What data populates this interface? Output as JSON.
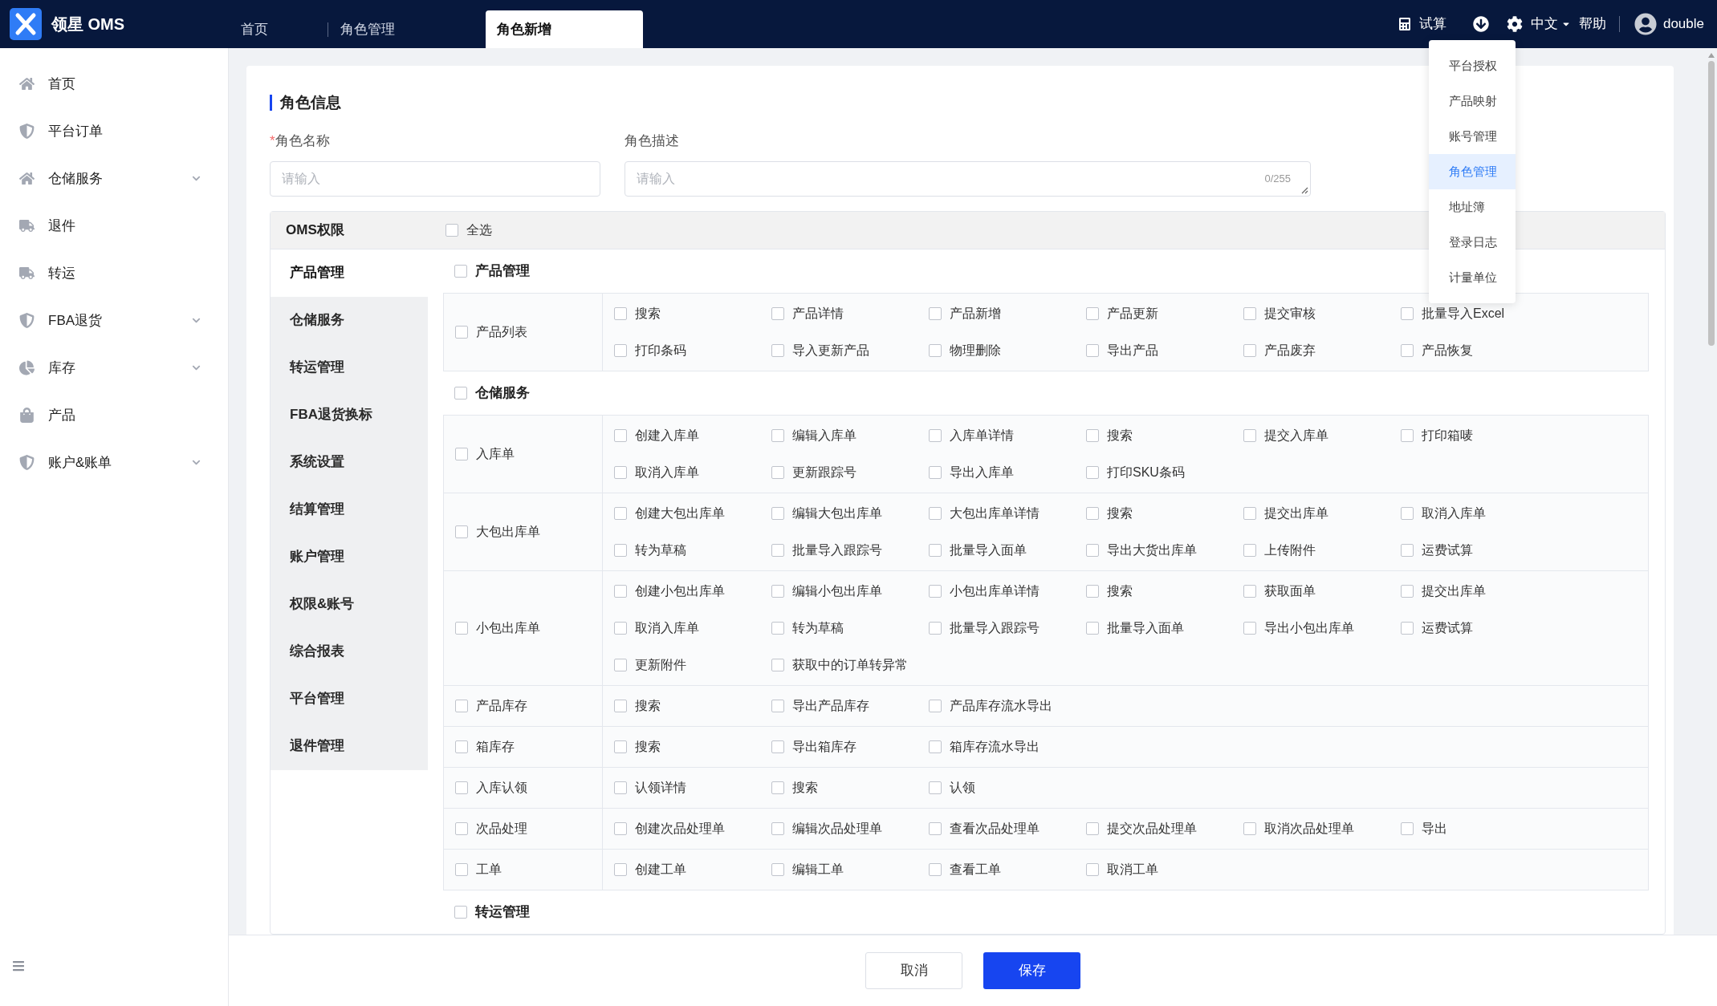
{
  "header": {
    "brand": "领星 OMS",
    "tabs": [
      {
        "label": "首页",
        "selected": false
      },
      {
        "label": "角色管理",
        "selected": false
      },
      {
        "label": "角色新增",
        "selected": true
      }
    ],
    "trial": "试算",
    "language": "中文",
    "help": "帮助",
    "user": "double"
  },
  "settings_menu": [
    {
      "label": "平台授权",
      "selected": false
    },
    {
      "label": "产品映射",
      "selected": false
    },
    {
      "label": "账号管理",
      "selected": false
    },
    {
      "label": "角色管理",
      "selected": true
    },
    {
      "label": "地址簿",
      "selected": false
    },
    {
      "label": "登录日志",
      "selected": false
    },
    {
      "label": "计量单位",
      "selected": false
    }
  ],
  "sidebar": {
    "items": [
      {
        "label": "首页",
        "expandable": false
      },
      {
        "label": "平台订单",
        "expandable": false
      },
      {
        "label": "仓储服务",
        "expandable": true
      },
      {
        "label": "退件",
        "expandable": false
      },
      {
        "label": "转运",
        "expandable": false
      },
      {
        "label": "FBA退货",
        "expandable": true
      },
      {
        "label": "库存",
        "expandable": true
      },
      {
        "label": "产品",
        "expandable": false
      },
      {
        "label": "账户&账单",
        "expandable": true
      }
    ]
  },
  "form": {
    "title": "角色信息",
    "name_field": {
      "required_mark": "*",
      "label": "角色名称",
      "placeholder": "请输入"
    },
    "description_field": {
      "label": "角色描述",
      "placeholder": "请输入",
      "counter": "0/255"
    }
  },
  "permissions": {
    "title": "OMS权限",
    "select_all": {
      "label": "全选",
      "checked": false
    },
    "modules": [
      {
        "label": "产品管理",
        "selected": true
      },
      {
        "label": "仓储服务",
        "selected": false
      },
      {
        "label": "转运管理",
        "selected": false
      },
      {
        "label": "FBA退货换标",
        "selected": false
      },
      {
        "label": "系统设置",
        "selected": false
      },
      {
        "label": "结算管理",
        "selected": false
      },
      {
        "label": "账户管理",
        "selected": false
      },
      {
        "label": "权限&账号",
        "selected": false
      },
      {
        "label": "综合报表",
        "selected": false
      },
      {
        "label": "平台管理",
        "selected": false
      },
      {
        "label": "退件管理",
        "selected": false
      }
    ],
    "groups": [
      {
        "label": "产品管理",
        "checked": false,
        "rows": [
          {
            "label": "产品列表",
            "checked": false,
            "items": [
              {
                "label": "搜索",
                "checked": false
              },
              {
                "label": "产品详情",
                "checked": false
              },
              {
                "label": "产品新增",
                "checked": false
              },
              {
                "label": "产品更新",
                "checked": false
              },
              {
                "label": "提交审核",
                "checked": false
              },
              {
                "label": "批量导入Excel",
                "checked": false
              },
              {
                "label": "打印条码",
                "checked": false
              },
              {
                "label": "导入更新产品",
                "checked": false
              },
              {
                "label": "物理删除",
                "checked": false
              },
              {
                "label": "导出产品",
                "checked": false
              },
              {
                "label": "产品废弃",
                "checked": false
              },
              {
                "label": "产品恢复",
                "checked": false
              }
            ]
          }
        ]
      },
      {
        "label": "仓储服务",
        "checked": false,
        "rows": [
          {
            "label": "入库单",
            "checked": false,
            "items": [
              {
                "label": "创建入库单",
                "checked": false
              },
              {
                "label": "编辑入库单",
                "checked": false
              },
              {
                "label": "入库单详情",
                "checked": false
              },
              {
                "label": "搜索",
                "checked": false
              },
              {
                "label": "提交入库单",
                "checked": false
              },
              {
                "label": "打印箱唛",
                "checked": false
              },
              {
                "label": "取消入库单",
                "checked": false
              },
              {
                "label": "更新跟踪号",
                "checked": false
              },
              {
                "label": "导出入库单",
                "checked": false
              },
              {
                "label": "打印SKU条码",
                "checked": false
              }
            ]
          },
          {
            "label": "大包出库单",
            "checked": false,
            "items": [
              {
                "label": "创建大包出库单",
                "checked": false
              },
              {
                "label": "编辑大包出库单",
                "checked": false
              },
              {
                "label": "大包出库单详情",
                "checked": false
              },
              {
                "label": "搜索",
                "checked": false
              },
              {
                "label": "提交出库单",
                "checked": false
              },
              {
                "label": "取消入库单",
                "checked": false
              },
              {
                "label": "转为草稿",
                "checked": false
              },
              {
                "label": "批量导入跟踪号",
                "checked": false
              },
              {
                "label": "批量导入面单",
                "checked": false
              },
              {
                "label": "导出大货出库单",
                "checked": false
              },
              {
                "label": "上传附件",
                "checked": false
              },
              {
                "label": "运费试算",
                "checked": false
              }
            ]
          },
          {
            "label": "小包出库单",
            "checked": false,
            "items": [
              {
                "label": "创建小包出库单",
                "checked": false
              },
              {
                "label": "编辑小包出库单",
                "checked": false
              },
              {
                "label": "小包出库单详情",
                "checked": false
              },
              {
                "label": "搜索",
                "checked": false
              },
              {
                "label": "获取面单",
                "checked": false
              },
              {
                "label": "提交出库单",
                "checked": false
              },
              {
                "label": "取消入库单",
                "checked": false
              },
              {
                "label": "转为草稿",
                "checked": false
              },
              {
                "label": "批量导入跟踪号",
                "checked": false
              },
              {
                "label": "批量导入面单",
                "checked": false
              },
              {
                "label": "导出小包出库单",
                "checked": false
              },
              {
                "label": "运费试算",
                "checked": false
              },
              {
                "label": "更新附件",
                "checked": false
              },
              {
                "label": "获取中的订单转异常",
                "checked": false
              }
            ]
          },
          {
            "label": "产品库存",
            "checked": false,
            "items": [
              {
                "label": "搜索",
                "checked": false
              },
              {
                "label": "导出产品库存",
                "checked": false
              },
              {
                "label": "产品库存流水导出",
                "checked": false
              }
            ]
          },
          {
            "label": "箱库存",
            "checked": false,
            "items": [
              {
                "label": "搜索",
                "checked": false
              },
              {
                "label": "导出箱库存",
                "checked": false
              },
              {
                "label": "箱库存流水导出",
                "checked": false
              }
            ]
          },
          {
            "label": "入库认领",
            "checked": false,
            "items": [
              {
                "label": "认领详情",
                "checked": false
              },
              {
                "label": "搜索",
                "checked": false
              },
              {
                "label": "认领",
                "checked": false
              }
            ]
          },
          {
            "label": "次品处理",
            "checked": false,
            "items": [
              {
                "label": "创建次品处理单",
                "checked": false
              },
              {
                "label": "编辑次品处理单",
                "checked": false
              },
              {
                "label": "查看次品处理单",
                "checked": false
              },
              {
                "label": "提交次品处理单",
                "checked": false
              },
              {
                "label": "取消次品处理单",
                "checked": false
              },
              {
                "label": "导出",
                "checked": false
              }
            ]
          },
          {
            "label": "工单",
            "checked": false,
            "items": [
              {
                "label": "创建工单",
                "checked": false
              },
              {
                "label": "编辑工单",
                "checked": false
              },
              {
                "label": "查看工单",
                "checked": false
              },
              {
                "label": "取消工单",
                "checked": false
              }
            ]
          }
        ]
      },
      {
        "label": "转运管理",
        "checked": false
      }
    ]
  },
  "footer": {
    "cancel": "取消",
    "save": "保存"
  }
}
